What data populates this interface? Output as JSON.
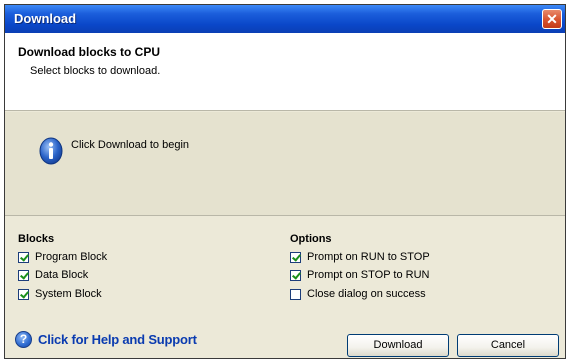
{
  "window": {
    "title": "Download"
  },
  "header": {
    "title": "Download blocks to CPU",
    "subtitle": "Select blocks to download."
  },
  "info": {
    "message": "Click Download to begin"
  },
  "blocks": {
    "title": "Blocks",
    "items": [
      {
        "label": "Program Block",
        "checked": true
      },
      {
        "label": "Data Block",
        "checked": true
      },
      {
        "label": "System Block",
        "checked": true
      }
    ]
  },
  "options": {
    "title": "Options",
    "items": [
      {
        "label": "Prompt on RUN to STOP",
        "checked": true
      },
      {
        "label": "Prompt on STOP to RUN",
        "checked": true
      },
      {
        "label": "Close dialog on success",
        "checked": false
      }
    ]
  },
  "help": {
    "label": "Click for Help and Support"
  },
  "buttons": {
    "download": "Download",
    "cancel": "Cancel"
  }
}
